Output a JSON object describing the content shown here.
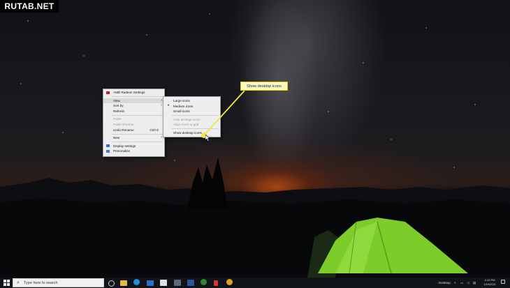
{
  "watermark": "RUTAB.NET",
  "callout": {
    "text": "Show desktop icons"
  },
  "context_menu": {
    "items": [
      {
        "label": "AMD Radeon Settings",
        "icon": "amd-radeon-icon"
      },
      {
        "label": "View",
        "submenu": true,
        "active": true
      },
      {
        "label": "Sort by",
        "submenu": true
      },
      {
        "label": "Refresh"
      },
      {
        "label": "Paste",
        "disabled": true
      },
      {
        "label": "Paste shortcut",
        "disabled": true
      },
      {
        "label": "Undo Rename",
        "shortcut": "Ctrl+Z"
      },
      {
        "label": "New",
        "submenu": true
      },
      {
        "label": "Display settings",
        "icon": "display-settings-icon"
      },
      {
        "label": "Personalize",
        "icon": "personalize-icon"
      }
    ]
  },
  "view_submenu": {
    "items": [
      {
        "label": "Large icons"
      },
      {
        "label": "Medium icons",
        "selected": true
      },
      {
        "label": "Small icons"
      },
      {
        "label": "Auto arrange icons",
        "disabled": true
      },
      {
        "label": "Align icons to grid",
        "disabled": true
      },
      {
        "label": "Show desktop icons",
        "highlighted": true
      }
    ]
  },
  "taskbar": {
    "search_placeholder": "Type here to search",
    "pinned_icons": [
      "task-view-icon",
      "file-explorer-icon",
      "edge-icon",
      "mail-icon",
      "store-icon",
      "calculator-icon",
      "word-icon",
      "xbox-icon",
      "snip-icon",
      "chrome-icon"
    ],
    "tray_label": "Desktop",
    "time": "4:10 PM",
    "date": "1/19/2021"
  },
  "colors": {
    "callout_bg": "#fff9c2",
    "callout_border": "#e8c800",
    "menu_bg": "#eeeeee",
    "taskbar_bg": "#101317",
    "tent": "#7ccc2a"
  }
}
